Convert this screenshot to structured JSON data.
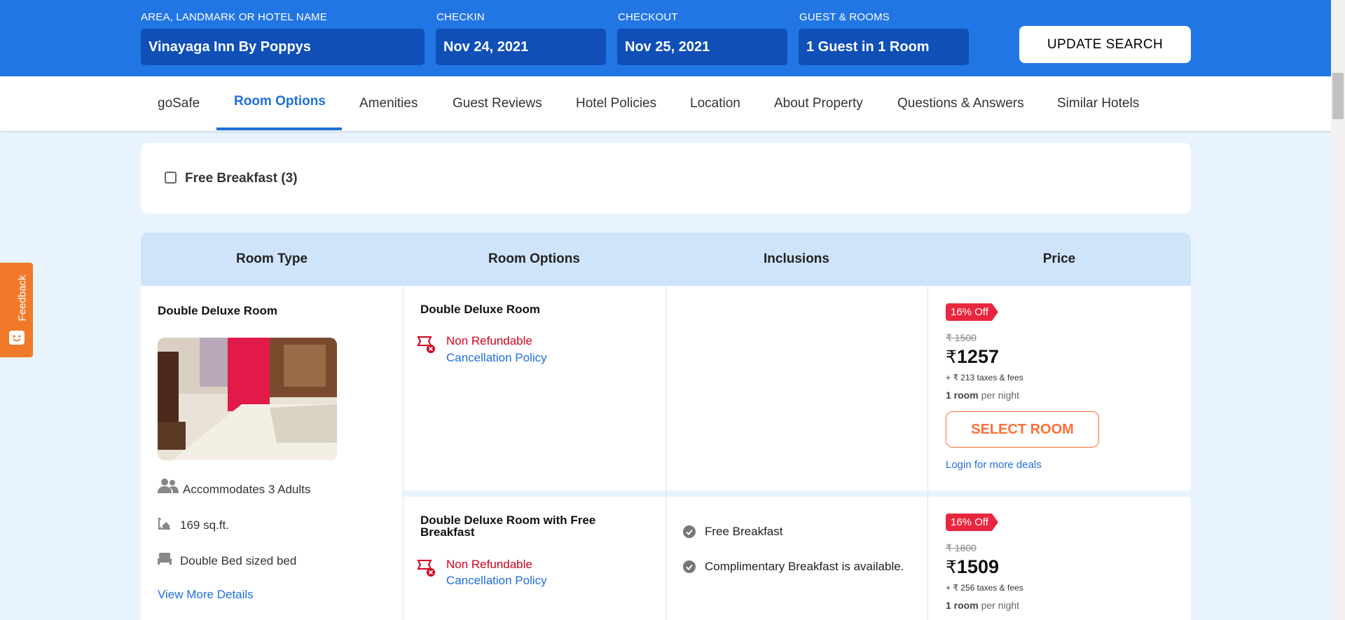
{
  "search": {
    "fields": [
      {
        "label": "AREA, LANDMARK OR HOTEL NAME",
        "value": "Vinayaga Inn By Poppys"
      },
      {
        "label": "CHECKIN",
        "value": "Nov 24, 2021"
      },
      {
        "label": "CHECKOUT",
        "value": "Nov 25, 2021"
      },
      {
        "label": "GUEST & ROOMS",
        "value": "1 Guest in 1 Room"
      }
    ],
    "update_label": "UPDATE SEARCH"
  },
  "nav": {
    "tabs": [
      "goSafe",
      "Room Options",
      "Amenities",
      "Guest Reviews",
      "Hotel Policies",
      "Location",
      "About Property",
      "Questions & Answers",
      "Similar Hotels"
    ],
    "active": "Room Options"
  },
  "filter": {
    "label": "Free Breakfast (3)",
    "checked": false
  },
  "table": {
    "headers": [
      "Room Type",
      "Room Options",
      "Inclusions",
      "Price"
    ]
  },
  "room": {
    "title": "Double Deluxe Room",
    "features": [
      "Accommodates 3 Adults",
      "169 sq.ft.",
      "Double Bed sized bed"
    ],
    "more_link": "View More Details"
  },
  "options": [
    {
      "title": "Double Deluxe Room",
      "refund": "Non Refundable",
      "policy_link": "Cancellation Policy",
      "inclusions": [],
      "badge": "16% Off",
      "original_price": "₹ 1500",
      "currency": "₹",
      "price": "1257",
      "taxes": "+ ₹ 213 taxes & fees",
      "per_night_bold": "1 room",
      "per_night_rest": " per night",
      "select_label": "SELECT ROOM",
      "deals_link": "Login for more deals"
    },
    {
      "title": "Double Deluxe Room with Free Breakfast",
      "refund": "Non Refundable",
      "policy_link": "Cancellation Policy",
      "inclusions": [
        "Free Breakfast",
        "Complimentary Breakfast is available."
      ],
      "badge": "16% Off",
      "original_price": "₹ 1800",
      "currency": "₹",
      "price": "1509",
      "taxes": "+ ₹ 256 taxes & fees",
      "per_night_bold": "1 room",
      "per_night_rest": " per night"
    }
  ],
  "feedback": {
    "label": "Feedback"
  },
  "colors": {
    "primary": "#2276e3",
    "field": "#0f4fb6",
    "accent": "#ff6d38",
    "badge": "#e8273f",
    "refund": "#d0021b",
    "link": "#1e6fd8"
  }
}
